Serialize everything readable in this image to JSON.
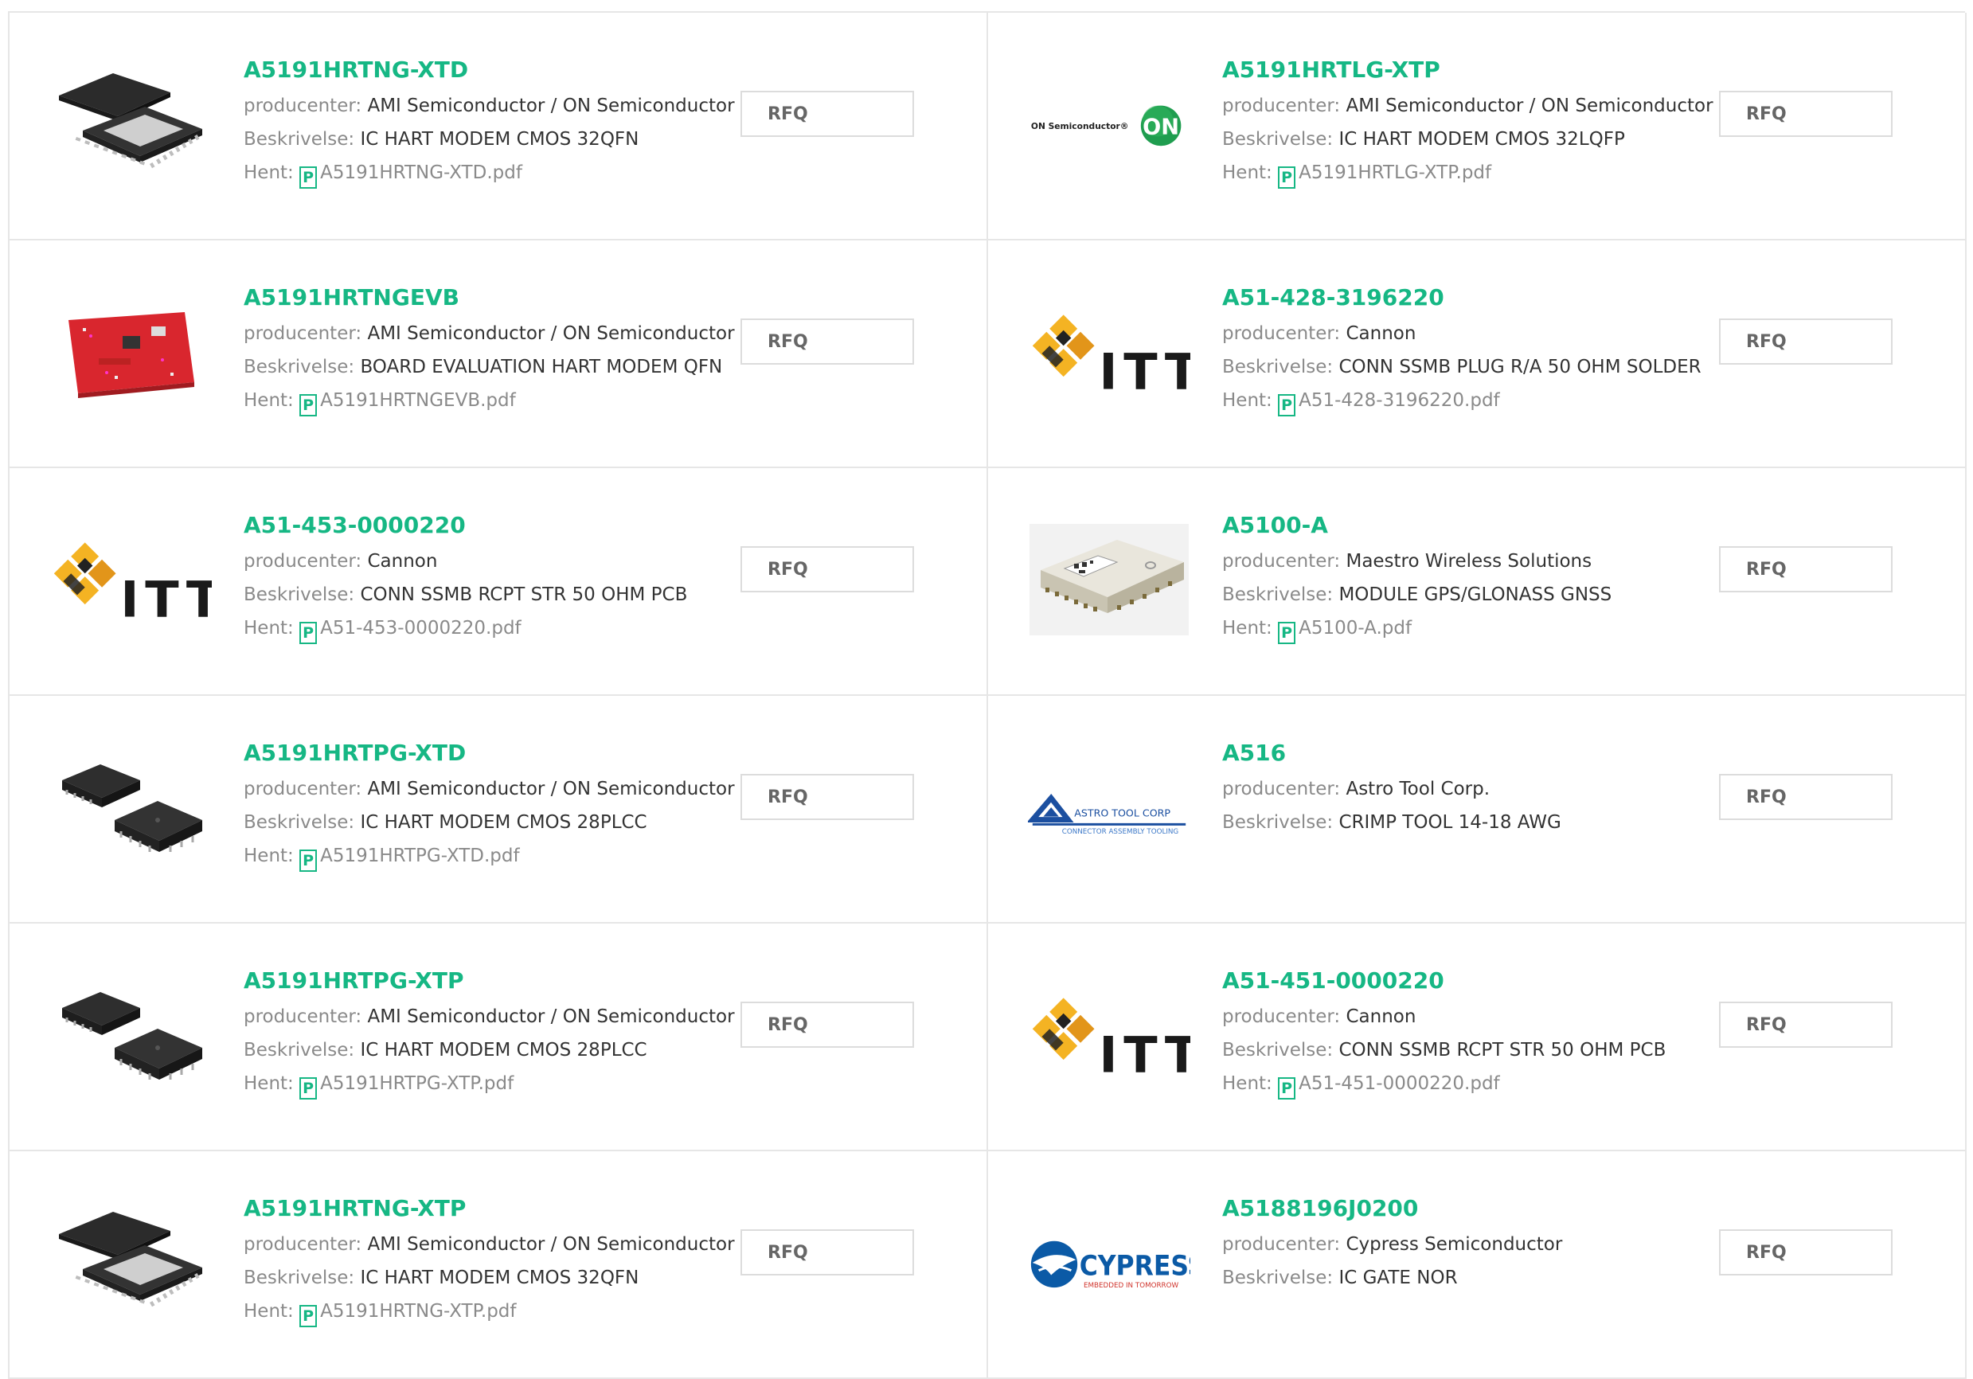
{
  "labels": {
    "manufacturer": "producenter:",
    "description": "Beskrivelse:",
    "download": "Hent:",
    "rfq": "RFQ",
    "pdf_glyph": "P"
  },
  "colors": {
    "accent": "#16b784",
    "border": "#e6e6e6"
  },
  "products": [
    {
      "part": "A5191HRTNG-XTD",
      "manufacturer": "AMI Semiconductor / ON Semiconductor",
      "description": "IC HART MODEM CMOS 32QFN",
      "file": "A5191HRTNG-XTD.pdf",
      "image": "qfn-chip"
    },
    {
      "part": "A5191HRTLG-XTP",
      "manufacturer": "AMI Semiconductor / ON Semiconductor",
      "description": "IC HART MODEM CMOS 32LQFP",
      "file": "A5191HRTLG-XTP.pdf",
      "image": "on-semiconductor-logo",
      "logo_text": "ON Semiconductor®",
      "logo_mark": "ON"
    },
    {
      "part": "A5191HRTNGEVB",
      "manufacturer": "AMI Semiconductor / ON Semiconductor",
      "description": "BOARD EVALUATION HART MODEM QFN",
      "file": "A5191HRTNGEVB.pdf",
      "image": "red-eval-board"
    },
    {
      "part": "A51-428-3196220",
      "manufacturer": "Cannon",
      "description": "CONN SSMB PLUG R/A 50 OHM SOLDER",
      "file": "A51-428-3196220.pdf",
      "image": "itt-logo",
      "logo_text": "ITT"
    },
    {
      "part": "A51-453-0000220",
      "manufacturer": "Cannon",
      "description": "CONN SSMB RCPT STR 50 OHM PCB",
      "file": "A51-453-0000220.pdf",
      "image": "itt-logo",
      "logo_text": "ITT"
    },
    {
      "part": "A5100-A",
      "manufacturer": "Maestro Wireless Solutions",
      "description": "MODULE GPS/GLONASS GNSS",
      "file": "A5100-A.pdf",
      "image": "gps-module"
    },
    {
      "part": "A5191HRTPG-XTD",
      "manufacturer": "AMI Semiconductor / ON Semiconductor",
      "description": "IC HART MODEM CMOS 28PLCC",
      "file": "A5191HRTPG-XTD.pdf",
      "image": "plcc-chips"
    },
    {
      "part": "A516",
      "manufacturer": "Astro Tool Corp.",
      "description": "CRIMP TOOL 14-18 AWG",
      "file": null,
      "image": "astro-tool-logo",
      "logo_text": "ASTRO TOOL CORP",
      "logo_subtext": "CONNECTOR ASSEMBLY TOOLING"
    },
    {
      "part": "A5191HRTPG-XTP",
      "manufacturer": "AMI Semiconductor / ON Semiconductor",
      "description": "IC HART MODEM CMOS 28PLCC",
      "file": "A5191HRTPG-XTP.pdf",
      "image": "plcc-chips"
    },
    {
      "part": "A51-451-0000220",
      "manufacturer": "Cannon",
      "description": "CONN SSMB RCPT STR 50 OHM PCB",
      "file": "A51-451-0000220.pdf",
      "image": "itt-logo",
      "logo_text": "ITT"
    },
    {
      "part": "A5191HRTNG-XTP",
      "manufacturer": "AMI Semiconductor / ON Semiconductor",
      "description": "IC HART MODEM CMOS 32QFN",
      "file": "A5191HRTNG-XTP.pdf",
      "image": "qfn-chip"
    },
    {
      "part": "A5188196J0200",
      "manufacturer": "Cypress Semiconductor",
      "description": "IC GATE NOR",
      "file": null,
      "image": "cypress-logo",
      "logo_text": "CYPRESS",
      "logo_subtext": "EMBEDDED IN TOMORROW"
    }
  ]
}
